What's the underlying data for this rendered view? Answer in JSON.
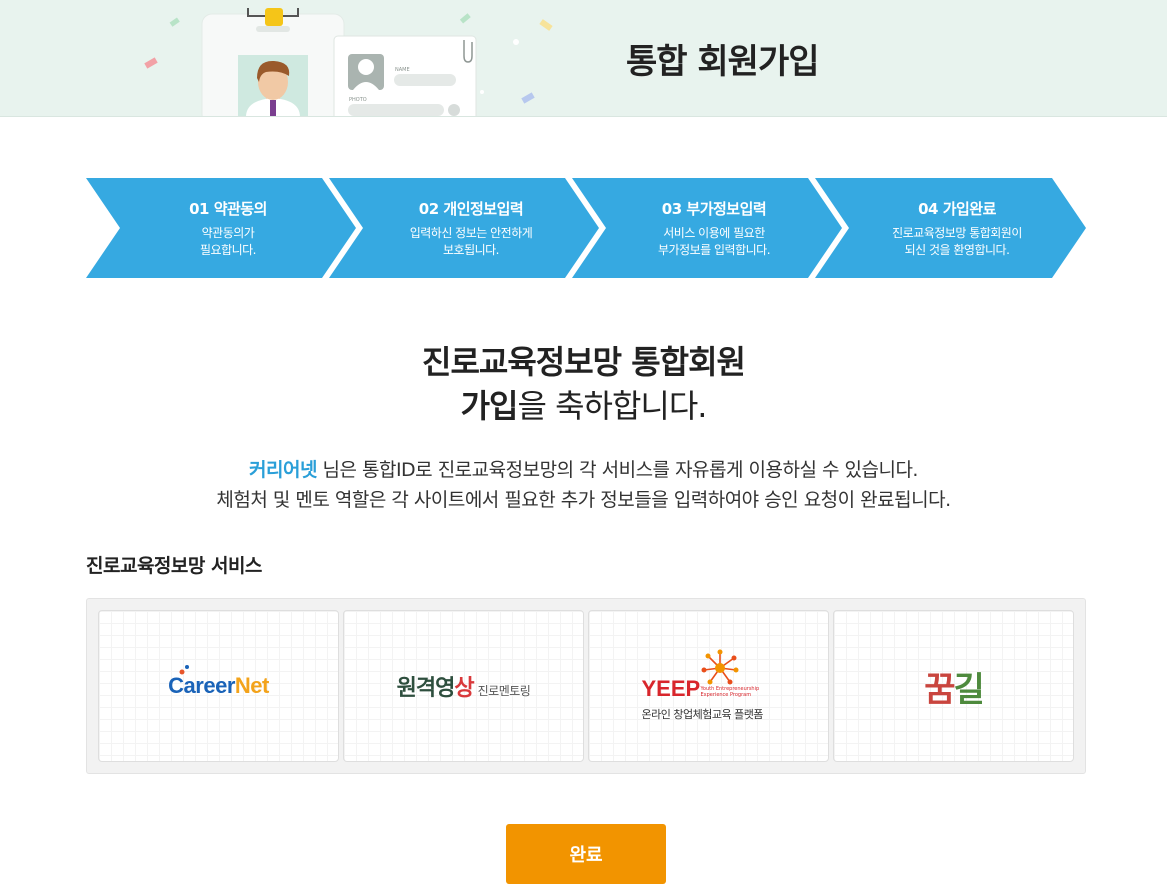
{
  "header": {
    "title": "통합 회원가입",
    "illustration_labels": {
      "name": "NAME",
      "photo": "PHOTO"
    }
  },
  "steps": [
    {
      "title": "01 약관동의",
      "desc_lines": [
        "약관동의가",
        "필요합니다."
      ]
    },
    {
      "title": "02 개인정보입력",
      "desc_lines": [
        "입력하신 정보는 안전하게",
        "보호됩니다."
      ]
    },
    {
      "title": "03 부가정보입력",
      "desc_lines": [
        "서비스 이용에 필요한",
        "부가정보를 입력합니다."
      ]
    },
    {
      "title": "04 가입완료",
      "desc_lines": [
        "진로교육정보망 통합회원이",
        "되신 것을 환영합니다."
      ]
    }
  ],
  "congrats": {
    "line1": "진로교육정보망 통합회원",
    "line2_bold": "가입",
    "line2_rest": "을 축하합니다."
  },
  "description": {
    "user_name": "커리어넷",
    "line1_rest": " 님은 통합ID로 진로교육정보망의 각 서비스를 자유롭게 이용하실 수 있습니다.",
    "line2": "체험처 및 멘토 역할은 각 사이트에서 필요한 추가 정보들을 입력하여야 승인 요청이 완료됩니다."
  },
  "services": {
    "title": "진로교육정보망 서비스",
    "items": [
      {
        "id": "careernet",
        "logo_main": "areer",
        "logo_accent": "Net",
        "logo_initial": "C"
      },
      {
        "id": "remote-mentoring",
        "logo_main": "원격영",
        "logo_accent": "상",
        "logo_small": "진로멘토링"
      },
      {
        "id": "yeep",
        "logo_main": "YEEP",
        "logo_tiny": "Youth Entrepreneurship Experience Program",
        "logo_sub": "온라인 창업체험교육 플랫폼"
      },
      {
        "id": "kkumgil",
        "logo_part1": "꿈",
        "logo_part2": "길"
      }
    ]
  },
  "actions": {
    "complete_label": "완료"
  },
  "colors": {
    "step_blue": "#36a9e1",
    "accent_blue": "#2a9fd8",
    "button_orange": "#f29400",
    "banner_bg": "#e8f3ee"
  }
}
